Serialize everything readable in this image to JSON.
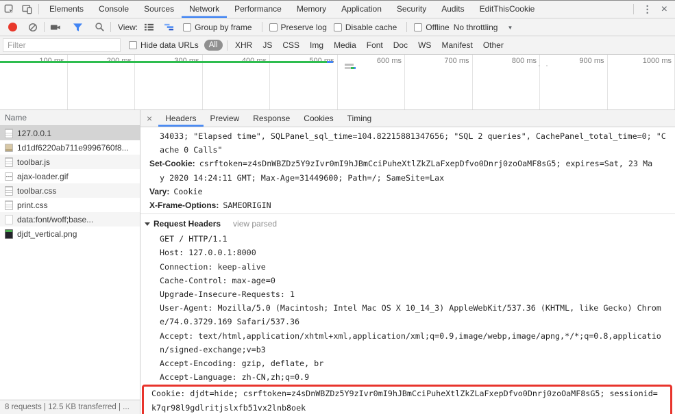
{
  "tabbar": {
    "tabs": [
      "Elements",
      "Console",
      "Sources",
      "Network",
      "Performance",
      "Memory",
      "Application",
      "Security",
      "Audits",
      "EditThisCookie"
    ],
    "selected": "Network"
  },
  "toolbar": {
    "view_label": "View:",
    "checkboxes": [
      "Group by frame",
      "Preserve log",
      "Disable cache",
      "Offline"
    ],
    "throttling": "No throttling"
  },
  "filter_bar": {
    "placeholder": "Filter",
    "hide_data_urls": "Hide data URLs",
    "pills": [
      "All",
      "XHR",
      "JS",
      "CSS",
      "Img",
      "Media",
      "Font",
      "Doc",
      "WS",
      "Manifest",
      "Other"
    ],
    "selected_pill": "All"
  },
  "timeline": {
    "ticks": [
      "100 ms",
      "200 ms",
      "300 ms",
      "400 ms",
      "500 ms",
      "600 ms",
      "700 ms",
      "800 ms",
      "900 ms",
      "1000 ms"
    ]
  },
  "sidebar": {
    "header": "Name",
    "rows": [
      {
        "name": "127.0.0.1",
        "icon": "document",
        "selected": true
      },
      {
        "name": "1d1df6220ab711e9996760f8...",
        "icon": "image"
      },
      {
        "name": "toolbar.js",
        "icon": "document"
      },
      {
        "name": "ajax-loader.gif",
        "icon": "image-dots"
      },
      {
        "name": "toolbar.css",
        "icon": "document"
      },
      {
        "name": "print.css",
        "icon": "document"
      },
      {
        "name": "data:font/woff;base...",
        "icon": "blank"
      },
      {
        "name": "djdt_vertical.png",
        "icon": "image-dark"
      }
    ],
    "status": "8 requests | 12.5 KB transferred | ..."
  },
  "detail": {
    "tabs": [
      "Headers",
      "Preview",
      "Response",
      "Cookies",
      "Timing"
    ],
    "selected_tab": "Headers",
    "response_lines": [
      {
        "t": "34033; \"Elapsed time\", SQLPanel_sql_time=104.82215881347656; \"SQL 2 queries\", CachePanel_total_time=0; \"C"
      },
      {
        "t": "ache 0 Calls\""
      },
      {
        "b": "Set-Cookie:",
        "t": "csrftoken=z4sDnWBZDz5Y9zIvr0mI9hJBmCciPuheXtlZkZLaFxepDfvo0Dnrj0zoOaMF8sG5; expires=Sat, 23 Ma"
      },
      {
        "t": "y 2020 14:24:11 GMT; Max-Age=31449600; Path=/; SameSite=Lax"
      },
      {
        "b": "Vary:",
        "t": "Cookie"
      },
      {
        "b": "X-Frame-Options:",
        "t": "SAMEORIGIN"
      }
    ],
    "request_section": {
      "title": "Request Headers",
      "action": "view parsed"
    },
    "request_lines": [
      "GET / HTTP/1.1",
      "Host: 127.0.0.1:8000",
      "Connection: keep-alive",
      "Cache-Control: max-age=0",
      "Upgrade-Insecure-Requests: 1",
      "User-Agent: Mozilla/5.0 (Macintosh; Intel Mac OS X 10_14_3) AppleWebKit/537.36 (KHTML, like Gecko) Chrom",
      "e/74.0.3729.169 Safari/537.36",
      "Accept: text/html,application/xhtml+xml,application/xml;q=0.9,image/webp,image/apng,*/*;q=0.8,applicatio",
      "n/signed-exchange;v=b3",
      "Accept-Encoding: gzip, deflate, br",
      "Accept-Language: zh-CN,zh;q=0.9"
    ],
    "highlighted_lines": [
      "Cookie: djdt=hide; csrftoken=z4sDnWBZDz5Y9zIvr0mI9hJBmCciPuheXtlZkZLaFxepDfvo0Dnrj0zoOaMF8sG5; sessionid=",
      "k7qr98l9gdlritjslxfb51vx2lnb8oek"
    ]
  },
  "colors": {
    "accent_blue": "#4285f4",
    "record_red": "#e8382b",
    "timeline_green": "#2ebd4f",
    "highlight_red": "#e8342c"
  }
}
